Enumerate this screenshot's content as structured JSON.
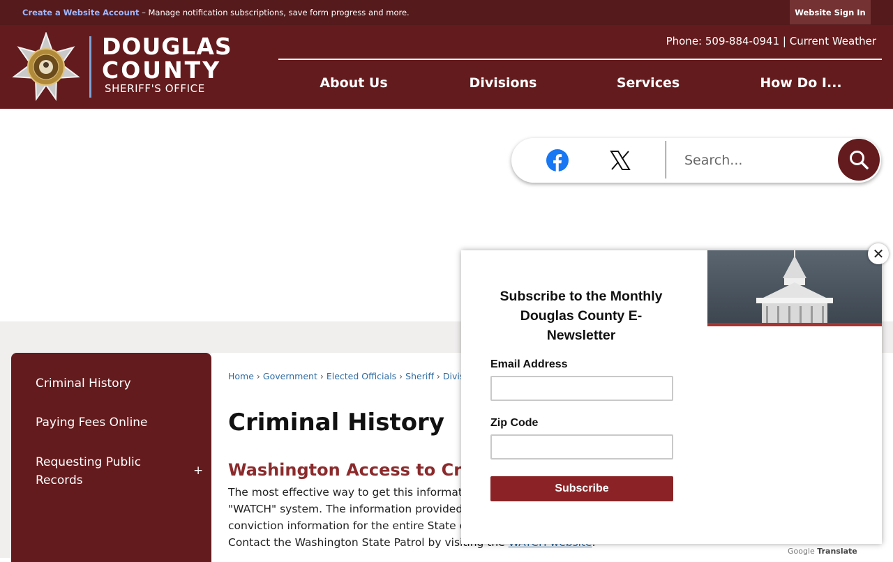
{
  "topbar": {
    "account_link": "Create a Website Account",
    "account_message": " – Manage notification subscriptions, save form progress and more.",
    "signin_label": "Website Sign In"
  },
  "header": {
    "logo_line1": "DOUGLAS",
    "logo_line2": "COUNTY",
    "logo_line3": "SHERIFF'S OFFICE",
    "badge_text_top": "DOUGLAS COUNTY",
    "badge_text_bottom": "SHERIFF'S OFFICE",
    "phone_label": "Phone: ",
    "phone_number": "509-884-0941",
    "separator": " | ",
    "weather_label": "Current Weather",
    "nav": [
      {
        "label": "About Us"
      },
      {
        "label": "Divisions"
      },
      {
        "label": "Services"
      },
      {
        "label": "How Do I..."
      }
    ]
  },
  "search": {
    "placeholder": "Search...",
    "social": [
      "facebook-icon",
      "x-icon"
    ]
  },
  "sidebar": {
    "items": [
      {
        "label": "Criminal History"
      },
      {
        "label": "Paying Fees Online"
      },
      {
        "label": "Requesting Public Records",
        "expand": "+"
      }
    ]
  },
  "breadcrumb": {
    "items": [
      "Home",
      "Government",
      "Elected Officials",
      "Sheriff",
      "Divisions"
    ],
    "sep": "›"
  },
  "main": {
    "page_title": "Criminal History",
    "section_title": "Washington Access to Crim",
    "para_lines": [
      "The most effective way to get this information",
      "\"WATCH\" system. The information provided by",
      "conviction information for the entire State of",
      "Contact the Washington State Patrol by visiting the "
    ],
    "para_link": "WATCH website",
    "para_end": "."
  },
  "translate": {
    "google": "Google",
    "translate": "Translate"
  },
  "modal": {
    "title": "Subscribe to the Monthly Douglas County E-Newsletter",
    "email_label": "Email Address",
    "zip_label": "Zip Code",
    "subscribe_label": "Subscribe",
    "close_label": "✕"
  },
  "colors": {
    "maroon": "#641b1d",
    "topbar": "#541a1c",
    "accent_red": "#8b2a2c",
    "link_blue": "#2f6da3"
  }
}
